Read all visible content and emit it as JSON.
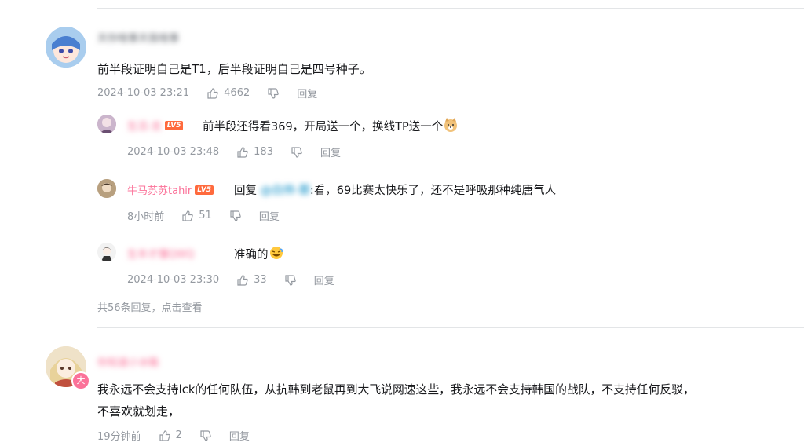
{
  "comments": [
    {
      "user": "天你啥事天我啥事",
      "text": "前半段证明自己是T1，后半段证明自己是四号种子。",
      "time": "2024-10-03 23:21",
      "likes": "4662",
      "reply_label": "回复",
      "replies": [
        {
          "user": "生活-支",
          "level": "LV5",
          "text": "前半段还得看369，开局送一个，换线TP送一个",
          "time": "2024-10-03 23:48",
          "likes": "183",
          "reply_label": "回复"
        },
        {
          "user": "牛马苏苏tahir",
          "level": "LV5",
          "reply_prefix": "回复",
          "mention": "@白帅-蓉",
          "text": ":看，69比赛太快乐了，还不是呼吸那种纯唐气人",
          "time": "8小时前",
          "likes": "51",
          "reply_label": "回复"
        },
        {
          "user": "生丰才懂QWQ",
          "text": "准确的",
          "time": "2024-10-03 23:30",
          "likes": "33",
          "reply_label": "回复"
        }
      ],
      "more_replies": "共56条回复，点击查看"
    },
    {
      "user": "你知道小冰箱",
      "avatar_badge": "大",
      "text_line1": "我永远不会支持lck的任何队伍，从抗韩到老鼠再到大飞说网速这些，我永远不会支持韩国的战队，不支持任何反驳，",
      "text_line2": "不喜欢就划走，",
      "time": "19分钟前",
      "likes": "2",
      "reply_label": "回复"
    }
  ]
}
